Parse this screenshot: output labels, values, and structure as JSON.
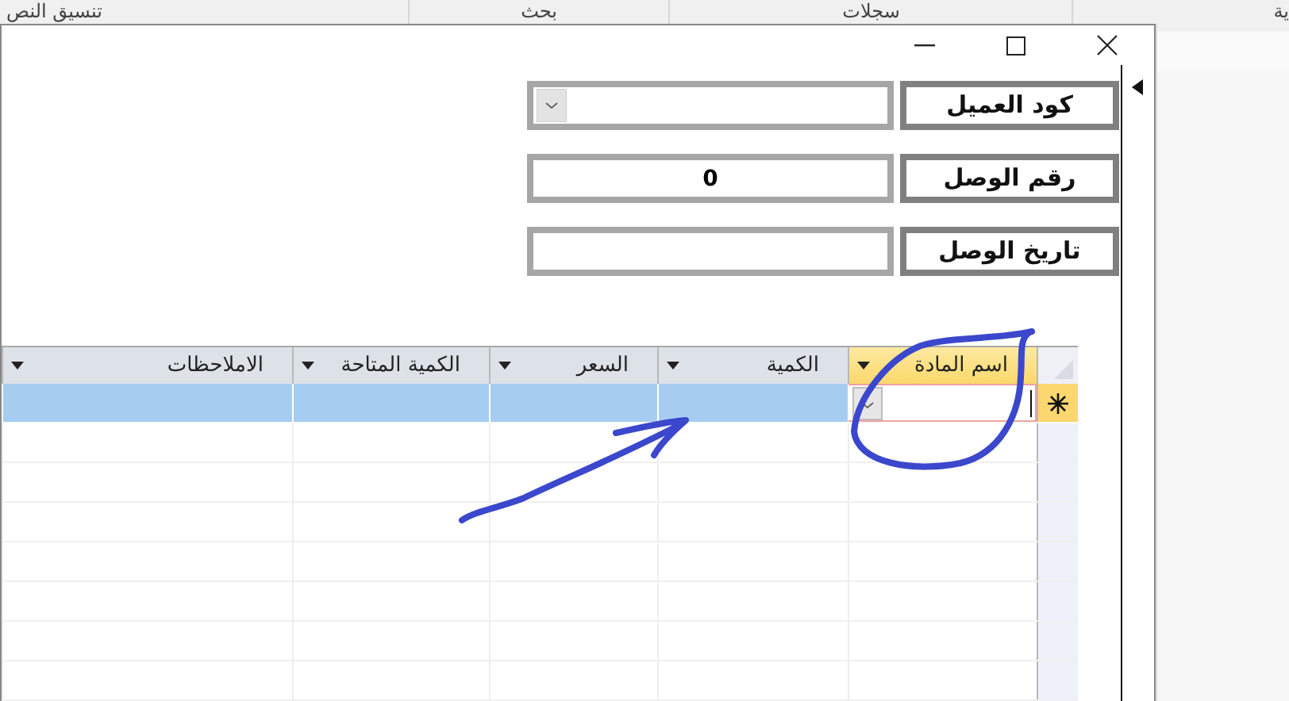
{
  "ribbon": {
    "groups": [
      {
        "label": "ية"
      },
      {
        "label": "سجلات"
      },
      {
        "label": "بحث"
      },
      {
        "label": "تنسيق النص"
      }
    ]
  },
  "form": {
    "fields": [
      {
        "label": "كود العميل",
        "kind": "combo"
      },
      {
        "label": "رقم الوصل",
        "kind": "text",
        "value": "0"
      },
      {
        "label": "تاريخ الوصل",
        "kind": "text"
      }
    ]
  },
  "subform": {
    "columns": [
      {
        "label": "اسم المادة",
        "kind": "combo",
        "selected": true
      },
      {
        "label": "الكمية",
        "selected": false
      },
      {
        "label": "السعر",
        "selected": false
      },
      {
        "label": "الكمية المتاحة",
        "selected": false
      },
      {
        "label": "الاملاحظات",
        "selected": false
      }
    ],
    "rows": [
      {
        "selected": true
      },
      {
        "selected": false
      },
      {
        "selected": false
      },
      {
        "selected": false
      },
      {
        "selected": false
      },
      {
        "selected": false
      },
      {
        "selected": false
      },
      {
        "selected": false
      }
    ]
  }
}
